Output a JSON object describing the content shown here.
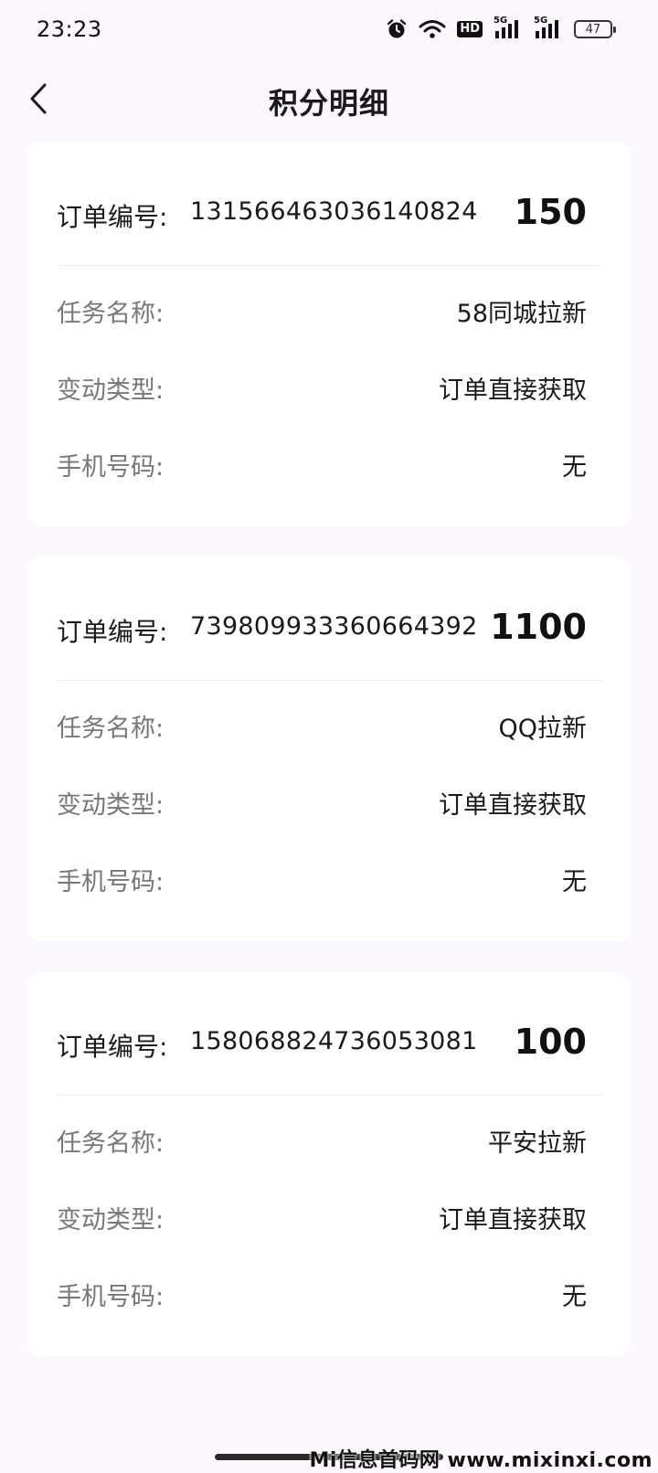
{
  "status_bar": {
    "time": "23:23",
    "signal_label_1": "5G",
    "signal_label_2": "5G",
    "hd_label": "HD",
    "battery": "47",
    "icons": [
      "alarm-icon",
      "wifi-icon",
      "hd-icon",
      "signal-icon",
      "signal-icon",
      "battery-icon"
    ]
  },
  "nav": {
    "title": "积分明细",
    "back_icon": "chevron-left-icon"
  },
  "labels": {
    "order": "订单编号:",
    "task": "任务名称:",
    "change_type": "变动类型:",
    "phone": "手机号码:"
  },
  "records": [
    {
      "order_number": "1315664630361408​24",
      "points": "150",
      "task_name": "58同城拉新",
      "change_type": "订单直接获取",
      "phone": "无"
    },
    {
      "order_number": "739809933360664392",
      "points": "1100",
      "task_name": "QQ拉新",
      "change_type": "订单直接获取",
      "phone": "无"
    },
    {
      "order_number": "1580688247360530​81",
      "points": "100",
      "task_name": "平安拉新",
      "change_type": "订单直接获取",
      "phone": "无"
    }
  ],
  "watermark": "Mi信息首码网 www.mixinxi.com",
  "colors": {
    "background": "#fbf8fd",
    "card": "#ffffff",
    "label": "#777777",
    "text": "#1a1a1a"
  }
}
